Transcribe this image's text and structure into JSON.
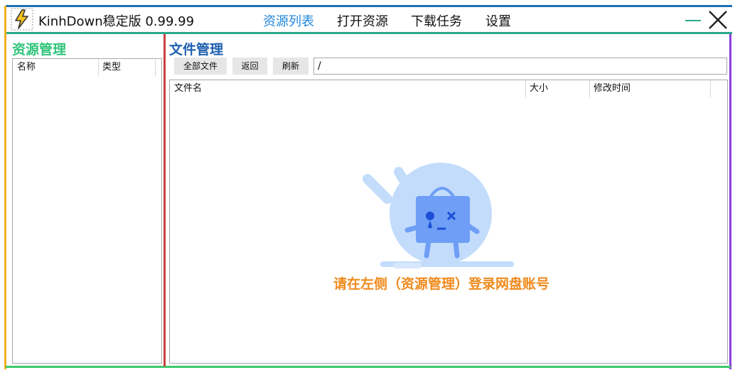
{
  "window": {
    "title": "KinhDown稳定版 0.99.99",
    "app_icon": "lightning-icon",
    "controls": {
      "minimize": "minimize-icon",
      "close": "close-icon"
    }
  },
  "nav": {
    "items": [
      {
        "label": "资源列表",
        "active": true
      },
      {
        "label": "打开资源",
        "active": false
      },
      {
        "label": "下载任务",
        "active": false
      },
      {
        "label": "设置",
        "active": false
      }
    ],
    "active_color": "#2288dd"
  },
  "resource_manager": {
    "title": "资源管理",
    "title_color": "#2fc47a",
    "columns": [
      "名称",
      "类型"
    ]
  },
  "file_manager": {
    "title": "文件管理",
    "title_color": "#1e5fb0",
    "toolbar": {
      "all_files": "全部文件",
      "back": "返回",
      "refresh": "刷新"
    },
    "path": "/",
    "columns": [
      "文件名",
      "大小",
      "修改时间"
    ],
    "empty_hint": "请在左侧（资源管理）登录网盘账号",
    "empty_hint_color": "#f08a1c"
  },
  "colors": {
    "top_border": "#1e6fb8",
    "title_underline": "#2aa98c",
    "left_border": "#f2b020",
    "right_border": "#8b3fd8",
    "bottom_border": "#3ec86a",
    "split_border": "#c94040"
  }
}
